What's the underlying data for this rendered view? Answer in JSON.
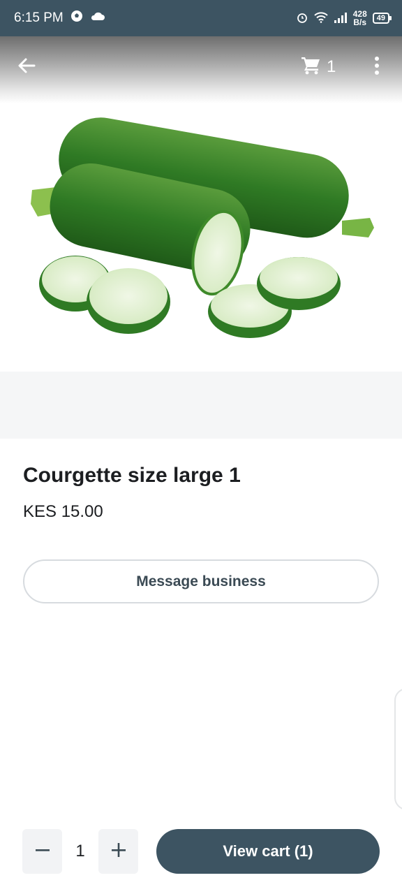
{
  "status_bar": {
    "time": "6:15 PM",
    "net_speed_value": "428",
    "net_speed_unit": "B/s",
    "battery": "49",
    "icons": [
      "soccer-ball-icon",
      "cloud-icon",
      "alarm-icon",
      "wifi-icon",
      "signal-icon",
      "battery-icon"
    ]
  },
  "toolbar": {
    "cart_count": "1",
    "icons": [
      "back-arrow-icon",
      "cart-icon",
      "more-vert-icon"
    ]
  },
  "product": {
    "title": "Courgette size large 1",
    "price": "KES 15.00",
    "image_label": "courgette-image"
  },
  "actions": {
    "message_label": "Message business",
    "quantity": "1",
    "view_cart_label": "View cart (1)"
  },
  "colors": {
    "primary": "#3d5462",
    "status_bar": "#3d5462",
    "strip": "#f5f6f7",
    "stepper_bg": "#f2f3f5"
  }
}
